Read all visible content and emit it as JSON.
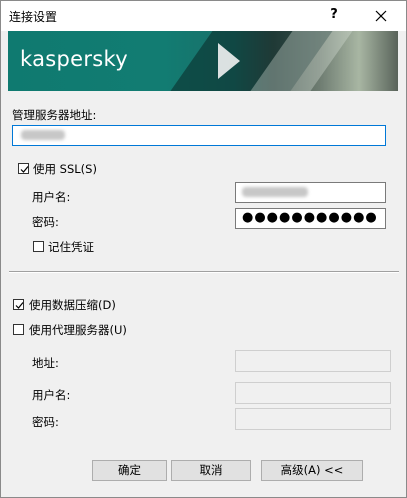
{
  "window": {
    "title": "连接设置",
    "help_symbol": "?"
  },
  "banner": {
    "logo_text": "kaspersky",
    "colors": {
      "teal": "#127c72",
      "logo": "#ffffff"
    }
  },
  "server": {
    "label": "管理服务器地址:",
    "value_redacted": true
  },
  "ssl": {
    "label": "使用 SSL(S)",
    "checked": true
  },
  "credentials": {
    "username_label": "用户名:",
    "password_label": "密码:",
    "password_mask": "●●●●●●●●●●●",
    "remember_label": "记住凭证",
    "remember_checked": false
  },
  "compression": {
    "label": "使用数据压缩(D)",
    "checked": true
  },
  "proxy": {
    "label": "使用代理服务器(U)",
    "checked": false,
    "address_label": "地址:",
    "username_label": "用户名:",
    "password_label": "密码:"
  },
  "buttons": {
    "ok": "确定",
    "cancel": "取消",
    "advanced": "高级(A) <<"
  }
}
